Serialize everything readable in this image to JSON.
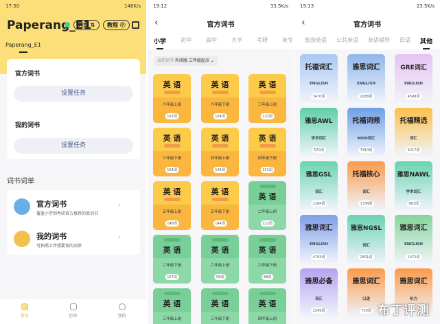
{
  "panel1": {
    "status": {
      "time": "17:50",
      "speed": "148K/s"
    },
    "title": "Paperang_E1",
    "sync_label": "同步 ⇅",
    "tutorial_label": "教程 ⓟ",
    "device_tab": "Paperang_E1",
    "official": {
      "label": "官方词书",
      "button": "设置任务"
    },
    "mine": {
      "label": "我的词书",
      "button": "设置任务"
    },
    "section": "词书词单",
    "list": [
      {
        "title": "官方词书",
        "subtitle": "覆盖小学到考研官方推荐的单词书"
      },
      {
        "title": "我的词书",
        "subtitle": "可拍照上传想要背的词单"
      }
    ],
    "nav": [
      {
        "label": "单词"
      },
      {
        "label": "打印"
      },
      {
        "label": "我的"
      }
    ]
  },
  "panel2": {
    "status": {
      "time": "19:12",
      "speed": "33.5K/s"
    },
    "title": "官方词书",
    "tabs": [
      "小学",
      "初中",
      "高中",
      "大学",
      "考研",
      "英专"
    ],
    "selector": {
      "label": "当前词书",
      "value": "外研版·三年级起点 ⌄"
    },
    "books": [
      {
        "name": "英 语",
        "sub": "六年级上册",
        "count": "102词",
        "style": "orange"
      },
      {
        "name": "英 语",
        "sub": "六年级下册",
        "count": "104词",
        "style": "orange"
      },
      {
        "name": "英 语",
        "sub": "三年级上册",
        "count": "132词",
        "style": "orange"
      },
      {
        "name": "英 语",
        "sub": "三年级下册",
        "count": "154词",
        "style": "orange"
      },
      {
        "name": "英 语",
        "sub": "四年级上册",
        "count": "144词",
        "style": "orange"
      },
      {
        "name": "英 语",
        "sub": "四年级下册",
        "count": "131词",
        "style": "orange"
      },
      {
        "name": "英 语",
        "sub": "五年级上册",
        "count": "148词",
        "style": "orange"
      },
      {
        "name": "英 语",
        "sub": "五年级下册",
        "count": "144词",
        "style": "orange"
      },
      {
        "name": "英 语",
        "sub": "二年级上册",
        "count": "112词",
        "style": "green"
      },
      {
        "name": "英 语",
        "sub": "二年级下册",
        "count": "107词",
        "style": "green"
      },
      {
        "name": "英 语",
        "sub": "六年级上册",
        "count": "58词",
        "style": "green"
      },
      {
        "name": "英 语",
        "sub": "六年级下册",
        "count": "88词",
        "style": "green"
      },
      {
        "name": "英 语",
        "sub": "三年级上册",
        "count": "",
        "style": "green"
      },
      {
        "name": "英 语",
        "sub": "三年级下册",
        "count": "",
        "style": "green"
      },
      {
        "name": "英 语",
        "sub": "四年级上册",
        "count": "",
        "style": "green"
      }
    ]
  },
  "panel3": {
    "status": {
      "time": "19:13",
      "speed": "23.5K/s"
    },
    "title": "官方词书",
    "tabs": [
      "旅游英语",
      "公共英语",
      "英语辅导",
      "日语",
      "其他"
    ],
    "books": [
      {
        "name": "托福词汇",
        "sub": "ENGLISH",
        "count": "3470词",
        "color": "#a9c8f0"
      },
      {
        "name": "雅思词汇",
        "sub": "ENGLISH",
        "count": "2088词",
        "color": "#8fb6ea"
      },
      {
        "name": "GRE词汇",
        "sub": "ENGLISH",
        "count": "4598词",
        "color": "#e6c2f3"
      },
      {
        "name": "雅思AWL",
        "sub": "学术词汇",
        "count": "570词",
        "color": "#5fcfa8"
      },
      {
        "name": "托福词频",
        "sub": "9000词汇",
        "count": "7914词",
        "color": "#6f9fe6"
      },
      {
        "name": "托福精选",
        "sub": "词汇",
        "count": "5217词",
        "color": "#fbc04a"
      },
      {
        "name": "雅思GSL",
        "sub": "词汇",
        "count": "2284词",
        "color": "#6ad3b0"
      },
      {
        "name": "托福核心",
        "sub": "词汇",
        "count": "1334词",
        "color": "#fb9a4a"
      },
      {
        "name": "雅思NAWL",
        "sub": "学术词汇",
        "count": "963词",
        "color": "#6ad3b0"
      },
      {
        "name": "雅思词汇",
        "sub": "ENGLISH",
        "count": "4793词",
        "color": "#7f9ee9"
      },
      {
        "name": "雅思NGSL",
        "sub": "词汇",
        "count": "2801词",
        "color": "#6ad3b0"
      },
      {
        "name": "雅思词汇",
        "sub": "ENGLISH",
        "count": "1472词",
        "color": "#86d49a"
      },
      {
        "name": "雅思必备",
        "sub": "词汇",
        "count": "2249词",
        "color": "#b7a2f0"
      },
      {
        "name": "雅思词汇",
        "sub": "口语",
        "count": "750词",
        "color": "#fb9a4a"
      },
      {
        "name": "雅思词汇",
        "sub": "听力",
        "count": "",
        "color": "#fb9a4a"
      }
    ]
  },
  "watermark": "布丁评测"
}
